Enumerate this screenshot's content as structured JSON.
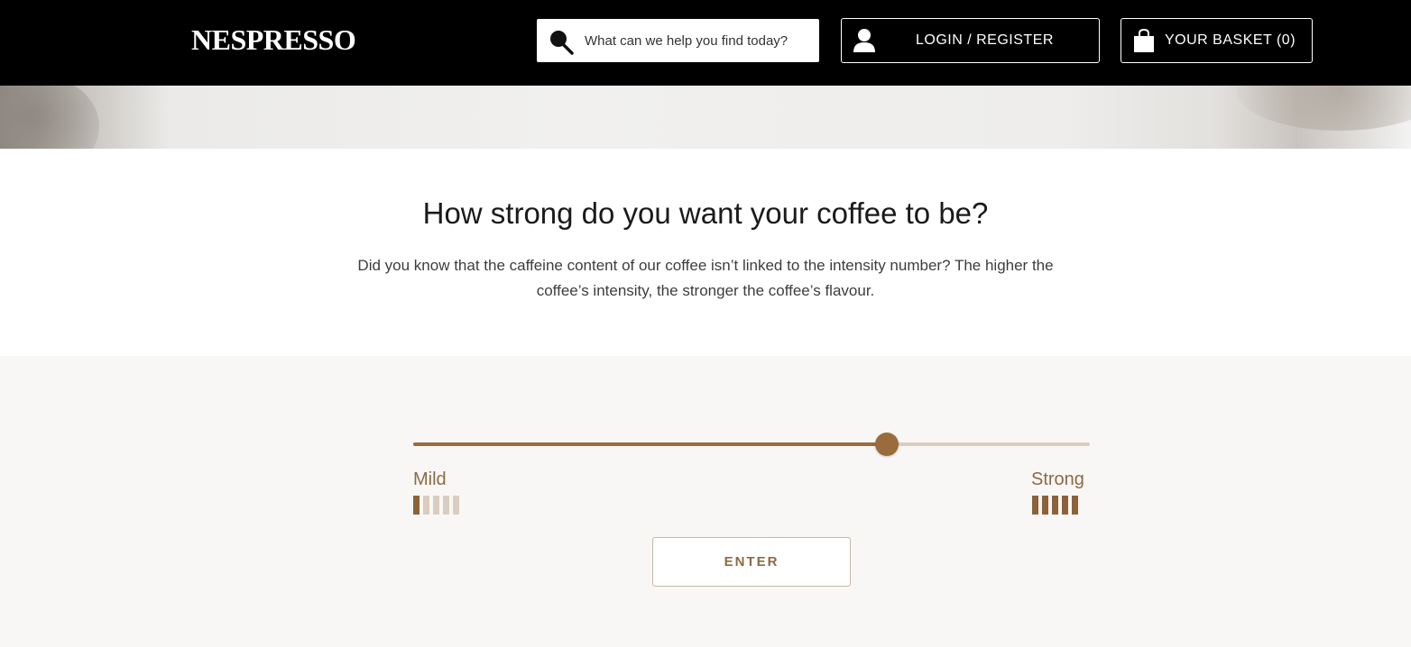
{
  "header": {
    "logo_text": "NESPRESSO",
    "search": {
      "placeholder": "What can we help you find today?",
      "icon": "search-icon"
    },
    "login": {
      "label": "LOGIN / REGISTER",
      "icon": "user-icon"
    },
    "basket": {
      "label": "YOUR BASKET (0)",
      "icon": "shopping-bag-icon"
    }
  },
  "main": {
    "title": "How strong do you want your coffee to be?",
    "description": "Did you know that the caffeine content of our coffee isn’t linked to the intensity number? The higher the coffee’s intensity, the stronger the coffee’s flavour."
  },
  "slider": {
    "value_fraction": 0.7,
    "min_label": "Mild",
    "max_label": "Strong",
    "min_bars_filled": 1,
    "max_bars_filled": 5,
    "bar_count": 5
  },
  "enter_button": {
    "label": "ENTER"
  },
  "colors": {
    "accent": "#9a6c3c",
    "accent_text": "#8b6a45",
    "track": "#d9cdbf",
    "header_bg": "#000000",
    "section_bg": "#f9f7f5"
  }
}
